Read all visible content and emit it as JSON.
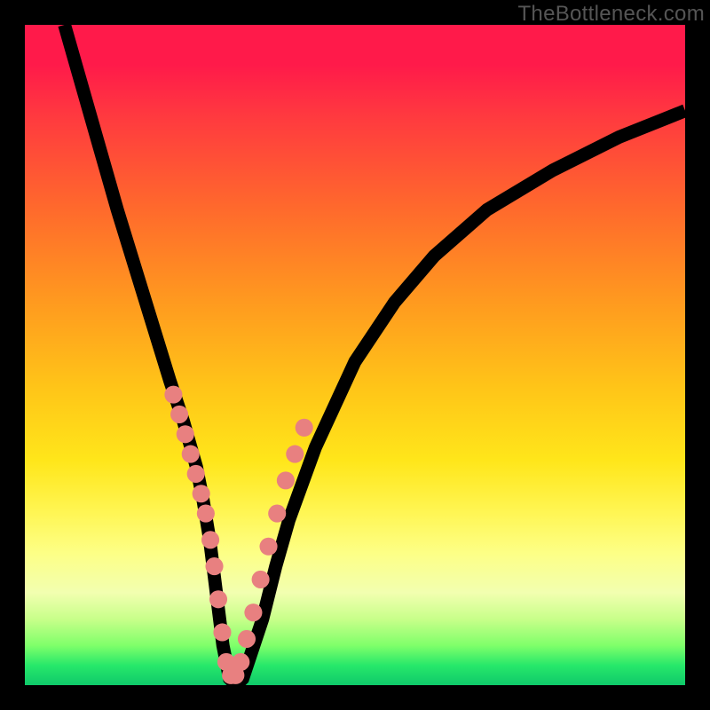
{
  "watermark": "TheBottleneck.com",
  "colors": {
    "gradient_top": "#ff1a4a",
    "gradient_mid": "#ffe61a",
    "gradient_bottom": "#0fc96a",
    "dot": "#e88080",
    "line": "#000000",
    "frame": "#000000"
  },
  "chart_data": {
    "type": "line",
    "title": "",
    "xlabel": "",
    "ylabel": "",
    "xlim": [
      0,
      100
    ],
    "ylim": [
      0,
      100
    ],
    "grid": false,
    "x": [
      6,
      10,
      14,
      18,
      22,
      24,
      26,
      27,
      28,
      29,
      30,
      31,
      32,
      33,
      34,
      36,
      38,
      40,
      44,
      50,
      56,
      62,
      70,
      80,
      90,
      100
    ],
    "values": [
      100,
      86,
      72,
      59,
      46,
      40,
      33,
      28,
      22,
      14,
      6,
      1,
      0,
      1,
      4,
      10,
      18,
      25,
      36,
      49,
      58,
      65,
      72,
      78,
      83,
      87
    ],
    "series": [
      {
        "name": "dots_cluster",
        "x": [
          22.5,
          23.4,
          24.3,
          25.1,
          25.9,
          26.7,
          27.4,
          28.1,
          28.7,
          29.3,
          29.9,
          30.5,
          31.2,
          31.9,
          32.7,
          33.6,
          34.6,
          35.7,
          36.9,
          38.2,
          39.5,
          40.9,
          42.3
        ],
        "values": [
          44,
          41,
          38,
          35,
          32,
          29,
          26,
          22,
          18,
          13,
          8,
          3.5,
          1.5,
          1.5,
          3.5,
          7,
          11,
          16,
          21,
          26,
          31,
          35,
          39
        ]
      }
    ],
    "legend": false
  }
}
